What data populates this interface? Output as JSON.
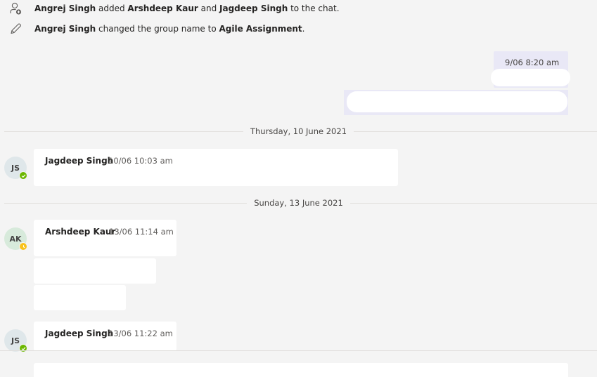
{
  "system_events": [
    {
      "icon": "add-person-icon",
      "actor": "Angrej Singh",
      "verb1": " added ",
      "target1": "Arshdeep Kaur",
      "joiner": " and ",
      "target2": "Jagdeep Singh",
      "tail": " to the chat."
    },
    {
      "icon": "pencil-icon",
      "actor": "Angrej Singh",
      "verb": " changed the group name to ",
      "name": "Agile Assignment",
      "tail": "."
    }
  ],
  "own_message": {
    "timestamp": "9/06 8:20 am"
  },
  "dividers": [
    {
      "label": "Thursday, 10 June 2021"
    },
    {
      "label": "Sunday, 13 June 2021"
    }
  ],
  "messages": [
    {
      "initials": "JS",
      "sender": "Jagdeep Singh",
      "time": "10/06 10:03 am",
      "presence": "available",
      "avatar_color": "#dfe7ea"
    },
    {
      "initials": "AK",
      "sender": "Arshdeep Kaur",
      "time": "13/06 11:14 am",
      "presence": "away",
      "avatar_color": "#d7eadb"
    },
    {
      "initials": "JS",
      "sender": "Jagdeep Singh",
      "time": "13/06 11:22 am",
      "presence": "available",
      "avatar_color": "#dfe7ea"
    }
  ],
  "colors": {
    "available": "#6bb700",
    "away": "#f8c21c",
    "own_bubble": "#e9e8f6",
    "background": "#f4f4f4"
  }
}
